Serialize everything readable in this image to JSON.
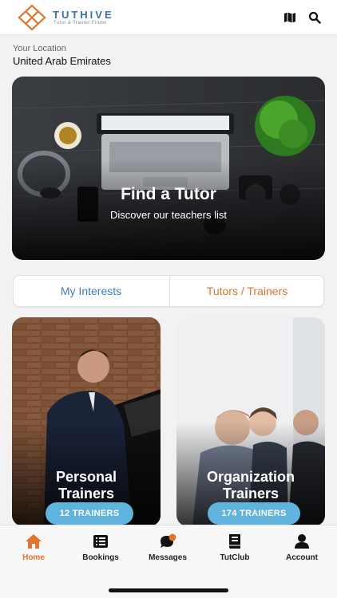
{
  "header": {
    "brand": "TUTHIVE",
    "tagline": "Tutor & Trainer Finder",
    "map_icon": "map-icon",
    "search_icon": "search-icon"
  },
  "location": {
    "label": "Your Location",
    "value": "United Arab Emirates"
  },
  "hero": {
    "title": "Find a Tutor",
    "subtitle": "Discover our teachers list"
  },
  "segments": {
    "left": "My Interests",
    "right": "Tutors / Trainers"
  },
  "cards": [
    {
      "title_line1": "Personal",
      "title_line2": "Trainers",
      "count_label": "12 TRAINERS"
    },
    {
      "title_line1": "Organization",
      "title_line2": "Trainers",
      "count_label": "174 TRAINERS"
    }
  ],
  "tabs": [
    {
      "label": "Home",
      "icon": "home-icon",
      "active": true
    },
    {
      "label": "Bookings",
      "icon": "list-icon",
      "active": false
    },
    {
      "label": "Messages",
      "icon": "chat-icon",
      "active": false
    },
    {
      "label": "TutClub",
      "icon": "book-icon",
      "active": false
    },
    {
      "label": "Account",
      "icon": "user-icon",
      "active": false
    }
  ],
  "colors": {
    "brand_blue": "#3b6ea5",
    "accent_orange": "#e0742a",
    "link_blue": "#3b7fc4",
    "pill_blue": "#5fb3dc"
  }
}
